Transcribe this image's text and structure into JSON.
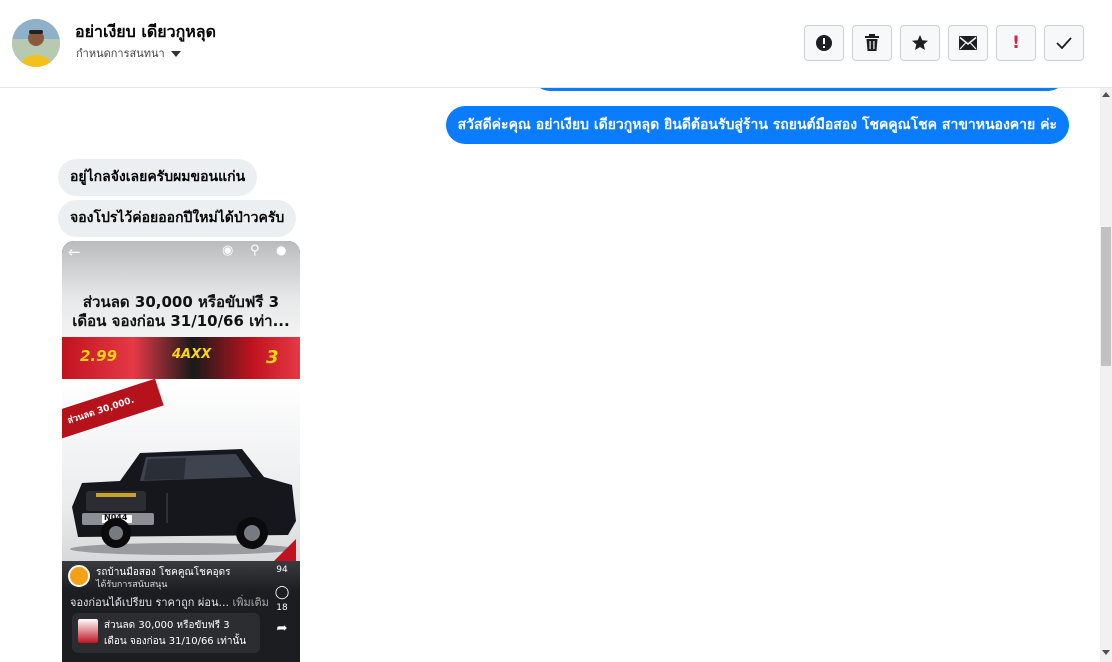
{
  "header": {
    "contact_name": "อย่าเงียบ เดียวกูหลุด",
    "contact_sub": "กำหนดการสนทนา",
    "actions": [
      {
        "icon": "alert-circle-icon"
      },
      {
        "icon": "trash-icon"
      },
      {
        "icon": "star-icon"
      },
      {
        "icon": "mail-icon"
      },
      {
        "icon": "exclamation-icon",
        "label": "!"
      },
      {
        "icon": "check-icon"
      }
    ]
  },
  "messages": {
    "outgoing_1": "สวัสดีค่ะคุณ อย่าเงียบ เดียวกูหลุด ยินดีต้อนรับสู่ร้าน รถยนต์มือสอง โชคคูณโชค สาขาหนองคาย ค่ะ",
    "incoming_1": "อยู่ไกลจังเลยครับผมขอนแก่น",
    "incoming_2": "จองโปรไว้ค่อยออกปีใหม่ได้ป่าวครับ"
  },
  "attachment": {
    "headline_line1": "ส่วนลด 30,000 หรือขับฟรี 3",
    "headline_line2": "เดือน จองก่อน 31/10/66 เท่า...",
    "banner_values": [
      "2.99",
      "4AXX",
      "3"
    ],
    "promo_ribbon": "ส่วนลด 30,000.",
    "plate": "N044",
    "page_name": "รถบ้านมือสอง โชคคูณโชคอุดร",
    "page_sub": "ได้รับการสนับสนุน",
    "description": "จองก่อนได้เปรียบ ราคาถูก ผ่อน...",
    "see_more": "เพิ่มเติม",
    "card_line1": "ส่วนลด 30,000 หรือขับฟรี 3",
    "card_line2": "เดือน จองก่อน 31/10/66 เท่านั้น",
    "likes": "94",
    "comments": "18"
  },
  "colors": {
    "outgoing_bubble": "#0a7cff",
    "incoming_bubble": "#eceff1",
    "alert_red": "#e41e3f"
  }
}
